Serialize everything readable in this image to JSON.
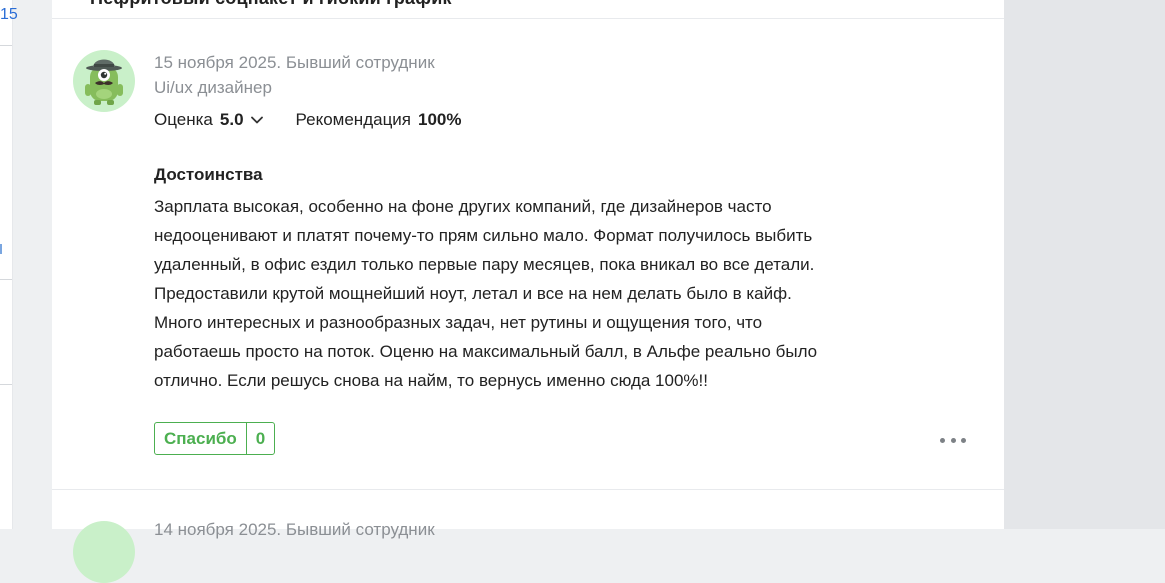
{
  "left_column": {
    "fragment_number": "15"
  },
  "previous_review": {
    "title_fragment": "Нефритовый соцпакет и гибкий график"
  },
  "review": {
    "date_status": "15 ноября 2025. Бывший сотрудник",
    "position": "Ui/ux дизайнер",
    "rating_label": "Оценка",
    "rating_value": "5.0",
    "recommendation_label": "Рекомендация",
    "recommendation_value": "100%",
    "pros_title": "Достоинства",
    "pros_lines": [
      "Зарплата высокая, особенно на фоне других компаний, где дизайнеров часто",
      "недооценивают и платят почему-то прям сильно мало. Формат получилось выбить",
      "удаленный, в офис ездил только первые пару месяцев, пока вникал во все детали.",
      "Предоставили крутой мощнейший ноут, летал и все на нем делать было в кайф.",
      "Много интересных и разнообразных задач, нет рутины и ощущения того, что",
      "работаешь просто на поток. Оценю на максимальный балл, в Альфе реально было",
      "отлично. Если решусь снова на найм, то вернусь именно сюда 100%!!"
    ],
    "thanks_label": "Спасибо",
    "thanks_count": "0"
  },
  "next_review": {
    "date_status_fragment": "14 ноября 2025. Бывший сотрудник"
  },
  "icons": {
    "avatar": "monster-avatar-icon",
    "rating_toggle": "chevron-down-icon",
    "more": "more-dots-icon"
  },
  "colors": {
    "accent_green": "#4caf50",
    "avatar_bg": "#c9f0c9",
    "meta_gray": "#8b8f94",
    "link_blue": "#2a6dd6"
  }
}
